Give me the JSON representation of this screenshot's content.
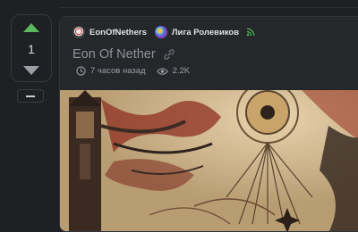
{
  "vote": {
    "count": "1"
  },
  "post": {
    "author": "EonOfNethers",
    "community": "Лига Ролевиков",
    "title": "Eon Of Nether",
    "time_ago": "7 часов назад",
    "views": "2.2K"
  },
  "colors": {
    "upvote": "#5cb85c",
    "downvote": "#9aa0a6",
    "rss": "#4caf50",
    "background": "#1e2024",
    "card": "#25272b"
  },
  "icons": {
    "upvote": "triangle-up-icon",
    "downvote": "triangle-down-icon",
    "collapse": "minus-icon",
    "rss": "rss-icon",
    "link": "link-icon",
    "clock": "clock-icon",
    "views": "eye-icon"
  }
}
